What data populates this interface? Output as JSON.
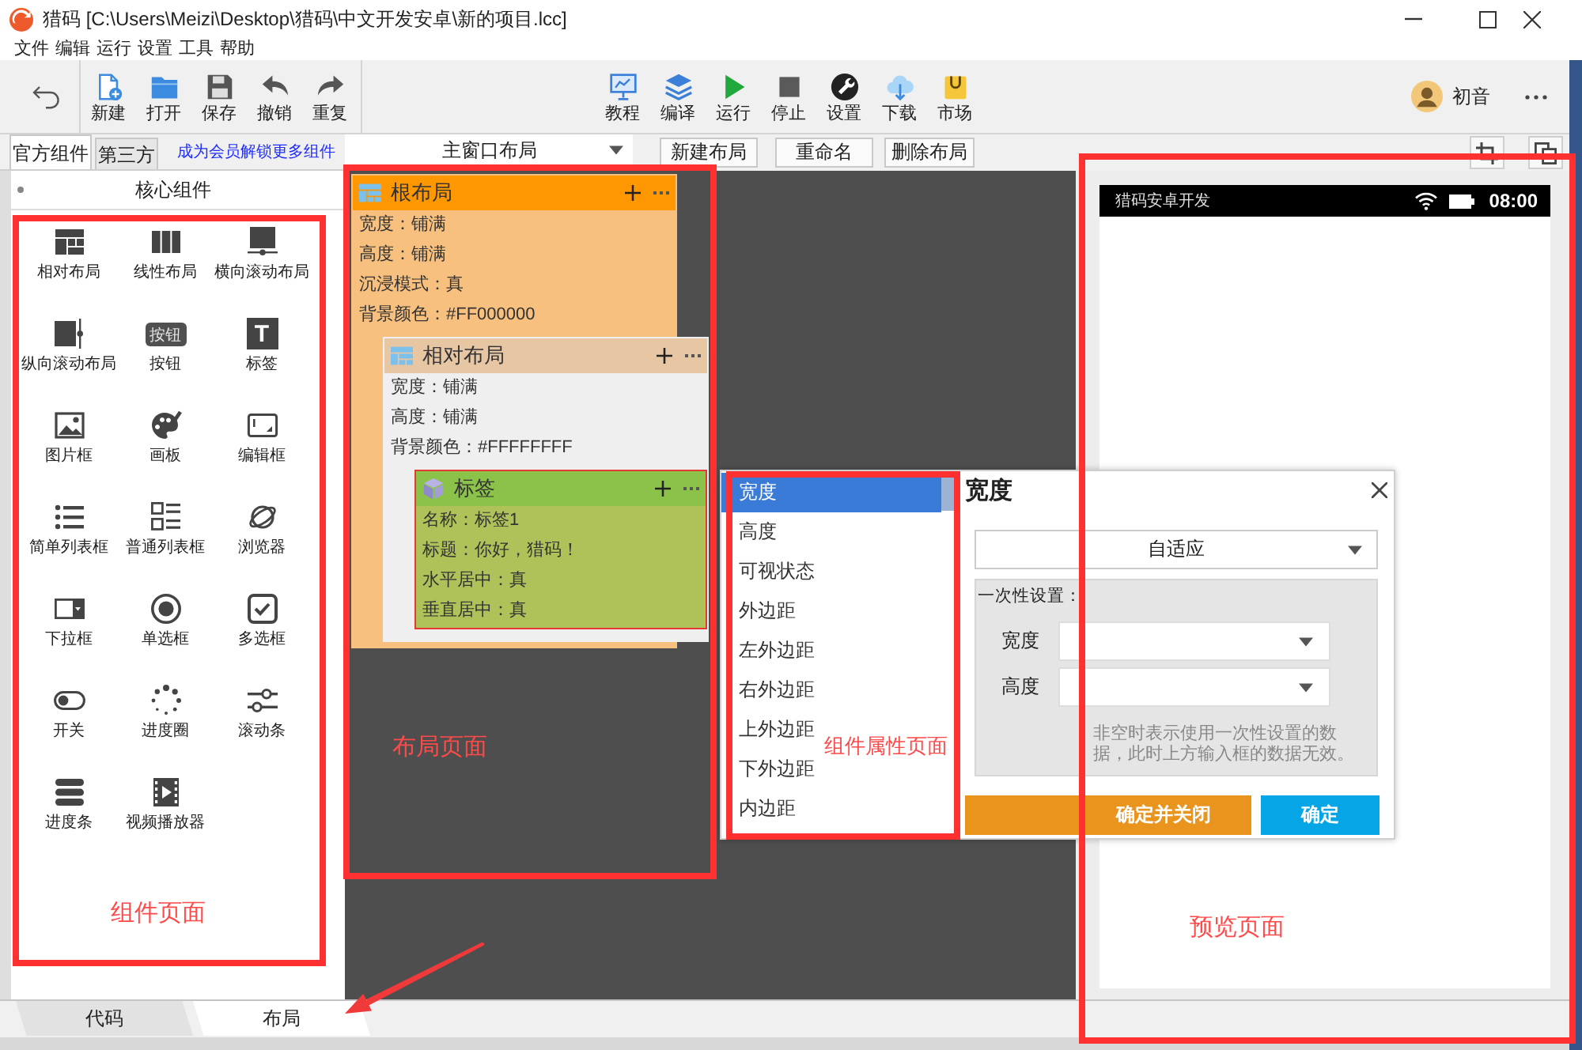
{
  "window": {
    "title": "猎码 [C:\\Users\\Meizi\\Desktop\\猎码\\中文开发安卓\\新的项目.lcc]"
  },
  "menu": [
    "文件",
    "编辑",
    "运行",
    "设置",
    "工具",
    "帮助"
  ],
  "toolbar": {
    "file_actions": [
      {
        "label": "新建"
      },
      {
        "label": "打开"
      },
      {
        "label": "保存"
      },
      {
        "label": "撤销"
      },
      {
        "label": "重复"
      }
    ],
    "project_actions": [
      {
        "label": "教程"
      },
      {
        "label": "编译"
      },
      {
        "label": "运行"
      },
      {
        "label": "停止"
      },
      {
        "label": "设置"
      },
      {
        "label": "下载"
      },
      {
        "label": "市场"
      }
    ],
    "user": {
      "name": "初音"
    }
  },
  "component_panel": {
    "tabs": [
      {
        "label": "官方组件",
        "selected": true
      },
      {
        "label": "第三方",
        "selected": false
      }
    ],
    "unlock_link": "成为会员解锁更多组件",
    "section": "核心组件",
    "rows": [
      {
        "items": [
          {
            "label": "相对布局"
          },
          {
            "label": "线性布局"
          },
          {
            "label": "横向滚动布局"
          }
        ]
      },
      {
        "items": [
          {
            "label": "纵向滚动布局"
          },
          {
            "label": "按钮",
            "icon_text": "按钮"
          },
          {
            "label": "标签",
            "icon_text": "T"
          }
        ]
      },
      {
        "items": [
          {
            "label": "图片框"
          },
          {
            "label": "画板"
          },
          {
            "label": "编辑框"
          }
        ]
      },
      {
        "items": [
          {
            "label": "简单列表框"
          },
          {
            "label": "普通列表框"
          },
          {
            "label": "浏览器"
          }
        ]
      },
      {
        "items": [
          {
            "label": "下拉框"
          },
          {
            "label": "单选框"
          },
          {
            "label": "多选框"
          }
        ]
      },
      {
        "items": [
          {
            "label": "开关"
          },
          {
            "label": "进度圈"
          },
          {
            "label": "滚动条"
          }
        ]
      },
      {
        "items": [
          {
            "label": "进度条"
          },
          {
            "label": "视频播放器"
          }
        ]
      }
    ]
  },
  "layout_bar": {
    "layout": "主窗口布局",
    "buttons": [
      "新建布局",
      "重命名",
      "删除布局"
    ]
  },
  "layout_tree": {
    "kind": "root",
    "title": "根布局",
    "selected": false,
    "props": [
      "宽度：铺满",
      "高度：铺满",
      "沉浸模式：真",
      "背景颜色：#FF000000"
    ],
    "children": [
      {
        "kind": "relative",
        "title": "相对布局",
        "selected": false,
        "props": [
          "宽度：铺满",
          "高度：铺满",
          "背景颜色：#FFFFFFFF"
        ],
        "children": [
          {
            "kind": "label",
            "title": "标签",
            "selected": true,
            "props": [
              "名称：标签1",
              "标题：你好，猎码！",
              "水平居中：真",
              "垂直居中：真"
            ]
          }
        ]
      }
    ]
  },
  "property_dialog": {
    "properties": [
      {
        "label": "宽度",
        "selected": true
      },
      {
        "label": "高度",
        "selected": false
      },
      {
        "label": "可视状态",
        "selected": false
      },
      {
        "label": "外边距",
        "selected": false
      },
      {
        "label": "左外边距",
        "selected": false
      },
      {
        "label": "右外边距",
        "selected": false
      },
      {
        "label": "上外边距",
        "selected": false
      },
      {
        "label": "下外边距",
        "selected": false
      },
      {
        "label": "内边距",
        "selected": false
      }
    ],
    "title": "宽度",
    "mode": "自适应",
    "one_time": {
      "heading": "一次性设置：",
      "fields": [
        {
          "label": "宽度"
        },
        {
          "label": "高度"
        }
      ],
      "note": "非空时表示使用一次性设置的数据，此时上方输入框的数据无效。"
    },
    "buttons": [
      {
        "label": "确定并关闭",
        "kind": "close"
      },
      {
        "label": "确定",
        "kind": "apply"
      }
    ]
  },
  "preview": {
    "status_bar": {
      "app_name": "猎码安卓开发",
      "time": "08:00"
    }
  },
  "bottom_tabs": [
    {
      "label": "代码",
      "selected": false
    },
    {
      "label": "布局",
      "selected": true
    }
  ],
  "annotations": [
    {
      "label": "组件页面"
    },
    {
      "label": "布局页面"
    },
    {
      "label": "组件属性页面"
    },
    {
      "label": "预览页面"
    }
  ]
}
